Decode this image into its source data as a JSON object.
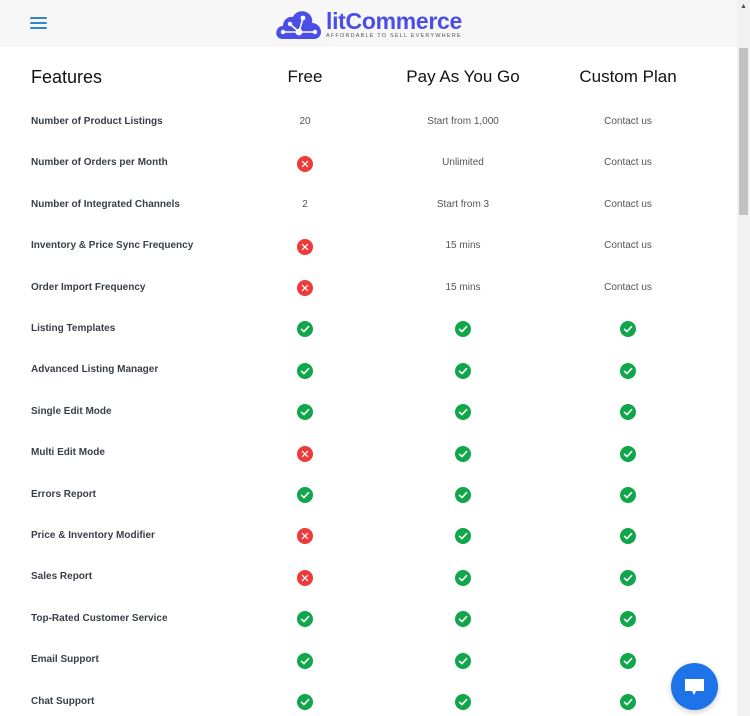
{
  "header": {
    "menu_icon": "hamburger-icon",
    "logo": {
      "name": "litCommerce",
      "tagline": "AFFORDABLE TO SELL EVERYWHERE",
      "icon": "cloud-network-icon",
      "brand_color": "#4a4de6"
    }
  },
  "table": {
    "headers": {
      "features": "Features",
      "plans": [
        "Free",
        "Pay As You Go",
        "Custom Plan"
      ]
    },
    "rows": [
      {
        "feature": "Number of Product Listings",
        "values": [
          "20",
          "Start from 1,000",
          "Contact us"
        ]
      },
      {
        "feature": "Number of Orders per Month",
        "values": [
          "no",
          "Unlimited",
          "Contact us"
        ]
      },
      {
        "feature": "Number of Integrated Channels",
        "values": [
          "2",
          "Start from 3",
          "Contact us"
        ]
      },
      {
        "feature": "Inventory & Price Sync Frequency",
        "values": [
          "no",
          "15 mins",
          "Contact us"
        ]
      },
      {
        "feature": "Order Import Frequency",
        "values": [
          "no",
          "15 mins",
          "Contact us"
        ]
      },
      {
        "feature": "Listing Templates",
        "values": [
          "yes",
          "yes",
          "yes"
        ]
      },
      {
        "feature": "Advanced Listing Manager",
        "values": [
          "yes",
          "yes",
          "yes"
        ]
      },
      {
        "feature": "Single Edit Mode",
        "values": [
          "yes",
          "yes",
          "yes"
        ]
      },
      {
        "feature": "Multi Edit Mode",
        "values": [
          "no",
          "yes",
          "yes"
        ]
      },
      {
        "feature": "Errors Report",
        "values": [
          "yes",
          "yes",
          "yes"
        ]
      },
      {
        "feature": "Price & Inventory Modifier",
        "values": [
          "no",
          "yes",
          "yes"
        ]
      },
      {
        "feature": "Sales Report",
        "values": [
          "no",
          "yes",
          "yes"
        ]
      },
      {
        "feature": "Top-Rated Customer Service",
        "values": [
          "yes",
          "yes",
          "yes"
        ]
      },
      {
        "feature": "Email Support",
        "values": [
          "yes",
          "yes",
          "yes"
        ]
      },
      {
        "feature": "Chat Support",
        "values": [
          "yes",
          "yes",
          "yes"
        ]
      }
    ]
  },
  "colors": {
    "check": "#10a64a",
    "cross": "#ee3a3a",
    "chat_button": "#1e73e8",
    "menu_icon": "#2f86c8"
  },
  "chat": {
    "icon": "chat-bubble-icon"
  }
}
